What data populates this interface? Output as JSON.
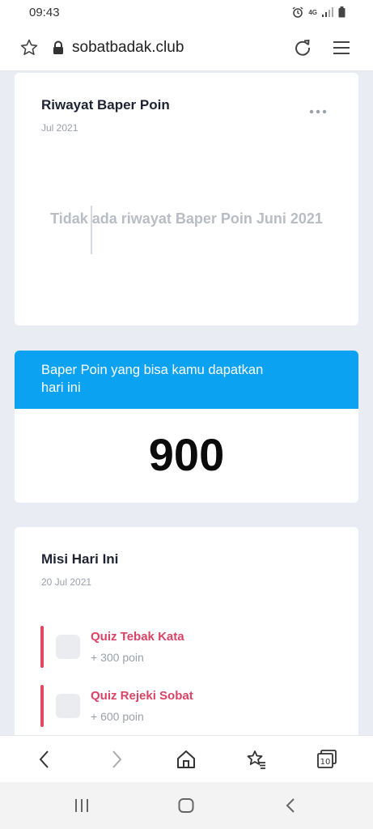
{
  "status_bar": {
    "time": "09:43",
    "network": "4G"
  },
  "browser": {
    "url": "sobatbadak.club",
    "icons": [
      "star-icon",
      "lock-icon",
      "reload-icon",
      "hamburger-menu-icon"
    ]
  },
  "history_card": {
    "title": "Riwayat Baper Poin",
    "date": "Jul 2021",
    "empty_message": "Tidak ada riwayat Baper Poin Juni 2021"
  },
  "points_card": {
    "header": "Baper Poin yang bisa kamu dapatkan hari ini",
    "value": "900",
    "accent_color": "#0ba2f1"
  },
  "mission_card": {
    "title": "Misi Hari Ini",
    "date": "20 Jul 2021",
    "items": [
      {
        "name": "Quiz Tebak Kata",
        "points": "+ 300 poin"
      },
      {
        "name": "Quiz Rejeki Sobat",
        "points": "+ 600 poin"
      }
    ],
    "accent_color": "#e14862"
  },
  "browser_nav": {
    "tabs_count": "10",
    "icons": [
      "back-icon",
      "forward-icon",
      "home-icon",
      "bookmarks-icon",
      "tabs-icon"
    ]
  },
  "system_nav": {
    "icons": [
      "recent-apps-icon",
      "home-icon",
      "back-icon"
    ]
  }
}
